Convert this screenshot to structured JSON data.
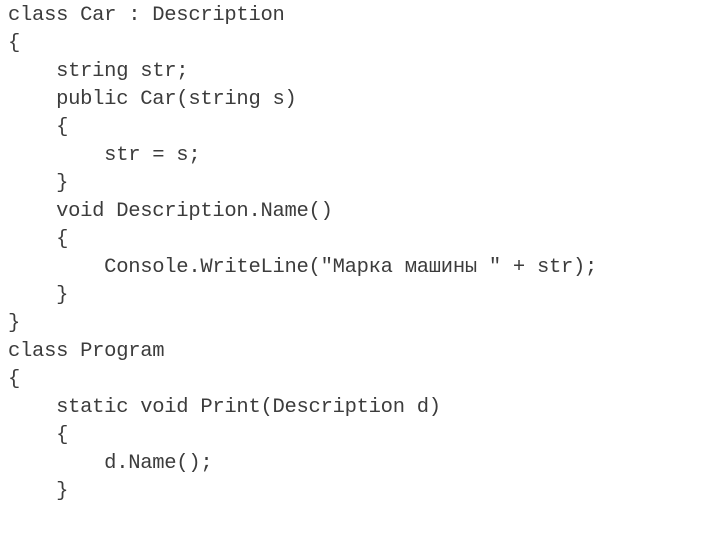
{
  "slide": {
    "background_color": "#ffffff",
    "text_color": "#3c3c3c",
    "language": "csharp"
  },
  "code": {
    "lines": [
      "class Car : Description",
      "{",
      "    string str;",
      "    public Car(string s)",
      "    {",
      "        str = s;",
      "    }",
      "    void Description.Name()",
      "    {",
      "        Console.WriteLine(\"Марка машины \" + str);",
      "    }",
      "}",
      "class Program",
      "{",
      "    static void Print(Description d)",
      "    {",
      "        d.Name();",
      "    }"
    ]
  }
}
